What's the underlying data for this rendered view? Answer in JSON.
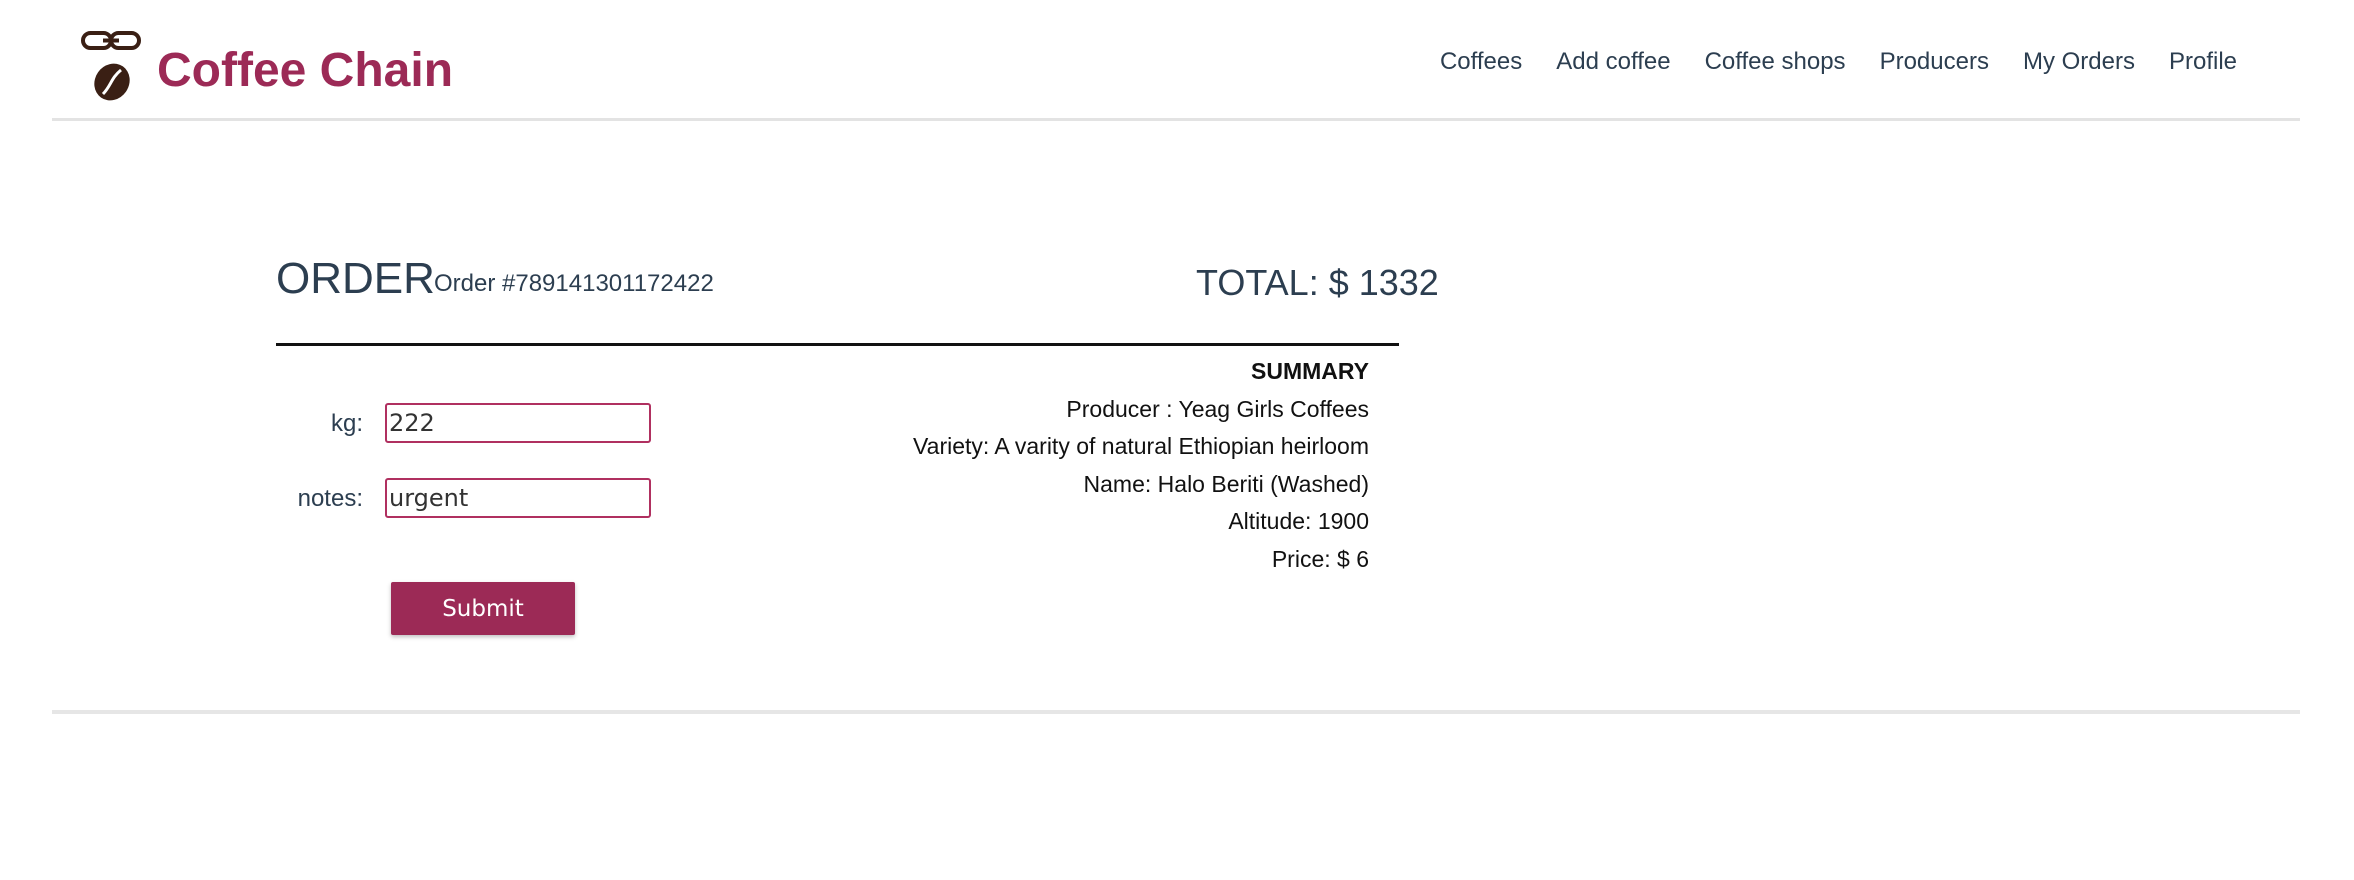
{
  "brand": {
    "name": "Coffee Chain",
    "logo_icon": "chain-coffee-bean-icon",
    "color": "#9c2a56"
  },
  "nav": {
    "items": [
      {
        "label": "Coffees"
      },
      {
        "label": "Add coffee"
      },
      {
        "label": "Coffee shops"
      },
      {
        "label": "Producers"
      },
      {
        "label": "My Orders"
      },
      {
        "label": "Profile"
      }
    ]
  },
  "order": {
    "title": "ORDER",
    "number": "Order #789141301172422",
    "total": "TOTAL: $ 1332"
  },
  "form": {
    "kg_label": "kg:",
    "kg_value": "222",
    "notes_label": "notes:",
    "notes_value": "urgent",
    "submit_label": "Submit"
  },
  "summary": {
    "heading": "SUMMARY",
    "producer": "Producer : Yeag Girls Coffees",
    "variety": "Variety: A varity of natural Ethiopian heirloom",
    "name": "Name: Halo Beriti (Washed)",
    "altitude": "Altitude: 1900",
    "price": "Price: $ 6"
  },
  "colors": {
    "accent": "#9c2a56",
    "text": "#2c3e50"
  }
}
